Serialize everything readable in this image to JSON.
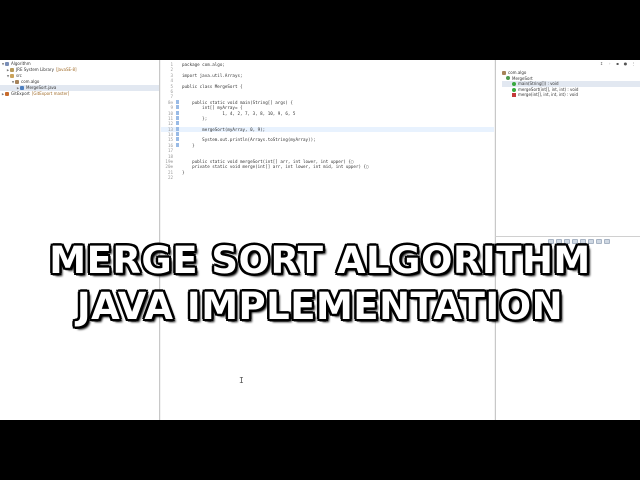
{
  "explorer": {
    "rows": [
      {
        "label": "Algorithm",
        "deco": ""
      },
      {
        "label": "JRE System Library",
        "deco": "[JavaSE-8]"
      },
      {
        "label": "src",
        "deco": ""
      },
      {
        "label": "com.algo",
        "deco": ""
      },
      {
        "label": "MergeSort.java",
        "deco": ""
      },
      {
        "label": "GitExport",
        "deco": "[GitExport master]"
      }
    ]
  },
  "editor": {
    "lines": [
      {
        "n": "1",
        "text": "package com.algo;"
      },
      {
        "n": "2",
        "text": ""
      },
      {
        "n": "3",
        "text": "import java.util.Arrays;"
      },
      {
        "n": "4",
        "text": ""
      },
      {
        "n": "5",
        "text": "public class MergeSort {"
      },
      {
        "n": "6",
        "text": ""
      },
      {
        "n": "7",
        "text": ""
      },
      {
        "n": "8⊖",
        "text": "    public static void main(String[] args) {"
      },
      {
        "n": "9",
        "text": "        int[] myArray= {"
      },
      {
        "n": "10",
        "text": "                1, 4, 2, 7, 3, 8, 10, 9, 6, 5"
      },
      {
        "n": "11",
        "text": "        };"
      },
      {
        "n": "12",
        "text": ""
      },
      {
        "n": "13",
        "text": "        mergeSort(myArray, 0, 9);"
      },
      {
        "n": "14",
        "text": ""
      },
      {
        "n": "15",
        "text": "        System.out.println(Arrays.toString(myArray));"
      },
      {
        "n": "16",
        "text": "    }"
      },
      {
        "n": "17",
        "text": ""
      },
      {
        "n": "18",
        "text": ""
      },
      {
        "n": "19⊕",
        "text": "    public static void mergeSort(int[] arr, int lower, int upper) {▢"
      },
      {
        "n": "20⊕",
        "text": "    private static void merge(int[] arr, int lower, int mid, int upper) {▢"
      },
      {
        "n": "21",
        "text": "}"
      },
      {
        "n": "22",
        "text": ""
      }
    ]
  },
  "outline": {
    "rows": [
      {
        "icon": "pkg",
        "label": "com.algo",
        "ret": ""
      },
      {
        "icon": "class",
        "label": "MergeSort",
        "ret": ""
      },
      {
        "icon": "pub",
        "label": "main(String[]) : void",
        "ret": ""
      },
      {
        "icon": "pub",
        "label": "mergeSort(int[], int, int) : void",
        "ret": ""
      },
      {
        "icon": "priv",
        "label": "merge(int[], int, int, int) : void",
        "ret": ""
      }
    ]
  },
  "overlay": {
    "line1": "MERGE SORT ALGORITHM",
    "line2": "JAVA IMPLEMENTATION"
  }
}
